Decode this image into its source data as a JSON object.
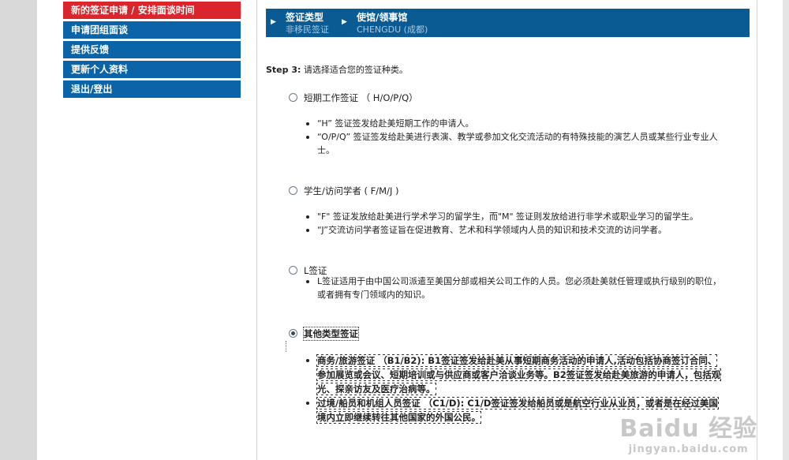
{
  "nav": {
    "items": [
      {
        "label": "新的签证申请  / 安排面谈时间",
        "active": true
      },
      {
        "label": "申请团组面谈"
      },
      {
        "label": "提供反馈"
      },
      {
        "label": "更新个人资料"
      },
      {
        "label": "退出/登出"
      }
    ]
  },
  "breadcrumb": {
    "crumbs": [
      {
        "title": "签证类型",
        "value": "非移民签证"
      },
      {
        "title": "使馆/领事馆",
        "value": "CHENGDU (成都)"
      }
    ]
  },
  "step": {
    "prefix": "Step 3:",
    "text": " 请选择适合您的签证种类。"
  },
  "options": [
    {
      "label": "短期工作签证 （ H/O/P/Q）",
      "checked": false,
      "bullets": [
        "“H” 签证签发给赴美短期工作的申请人。",
        "“O/P/Q” 签证签发给赴美进行表演、教学或参加文化交流活动的有特殊技能的演艺人员或某些行业专业人士。"
      ]
    },
    {
      "label": "学生/访问学者 ( F/M/J )",
      "checked": false,
      "bullets": [
        "\"F\" 签证发放给赴美进行学术学习的留学生，而\"M\" 签证则发放给进行非学术或职业学习的留学生。",
        "“J”交流访问学者签证旨在促进教育、艺术和科学领域内人员的知识和技术交流的访问学者。"
      ]
    },
    {
      "label": "L签证",
      "checked": false,
      "bullets": [
        "L签证适用于由中国公司派遣至美国分部或相关公司工作的人员。您必须赴美就任管理或执行级别的职位，或者拥有专门领域内的知识。"
      ]
    },
    {
      "label": "其他类型签证",
      "checked": true,
      "bullets": [
        "商务/旅游签证 （B1/B2): B1签证签发给赴美从事短期商务活动的申请人,活动包括协商签订合同、参加展览或会议、短期培训或与供应商或客户洽谈业务等。B2签证签发给赴美旅游的申请人，包括观光、探亲访友及医疗治病等。",
        "过境/船员和机组人员签证 （C1/D): C1/D签证签发给船员或是航空行业从业员，或者是在经过美国境内立即继续转往其他国家的外国公民。"
      ]
    }
  ],
  "watermark": {
    "brand": "Baidu 经验",
    "url": "jingyan.baidu.com"
  }
}
